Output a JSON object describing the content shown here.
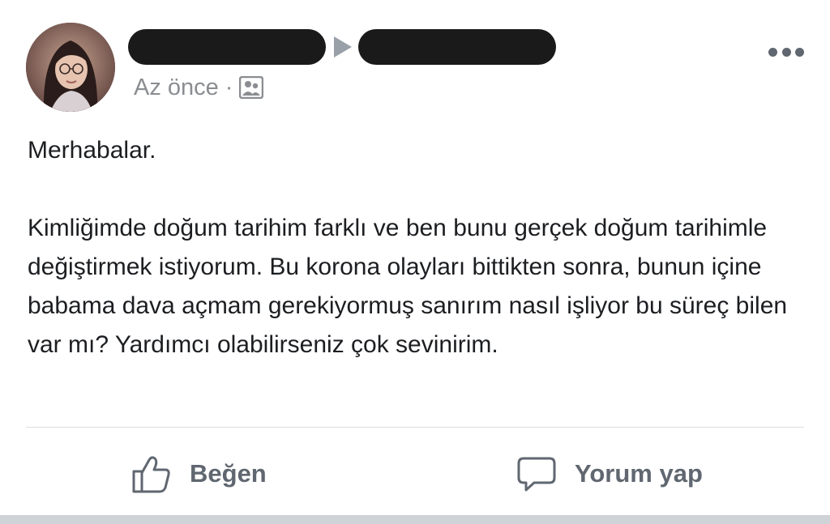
{
  "post": {
    "timestamp": "Az önce",
    "separator": "·",
    "audience_icon": "group-icon",
    "greeting": "Merhabalar.",
    "body": "Kimliğimde doğum tarihim farklı ve ben bunu gerçek doğum tarihimle değiştirmek istiyorum. Bu korona olayları bittikten sonra, bunun içine babama dava açmam gerekiyormuş sanırım nasıl işliyor bu süreç bilen var mı? Yardımcı olabilirseniz çok sevinirim."
  },
  "actions": {
    "like_label": "Beğen",
    "like_icon": "thumbs-up-icon",
    "comment_label": "Yorum yap",
    "comment_icon": "comment-bubble-icon"
  },
  "colors": {
    "text": "#1c1e21",
    "muted": "#8a8d91",
    "action": "#606770",
    "redaction": "#1a1a1a",
    "divider": "#dadde1"
  }
}
